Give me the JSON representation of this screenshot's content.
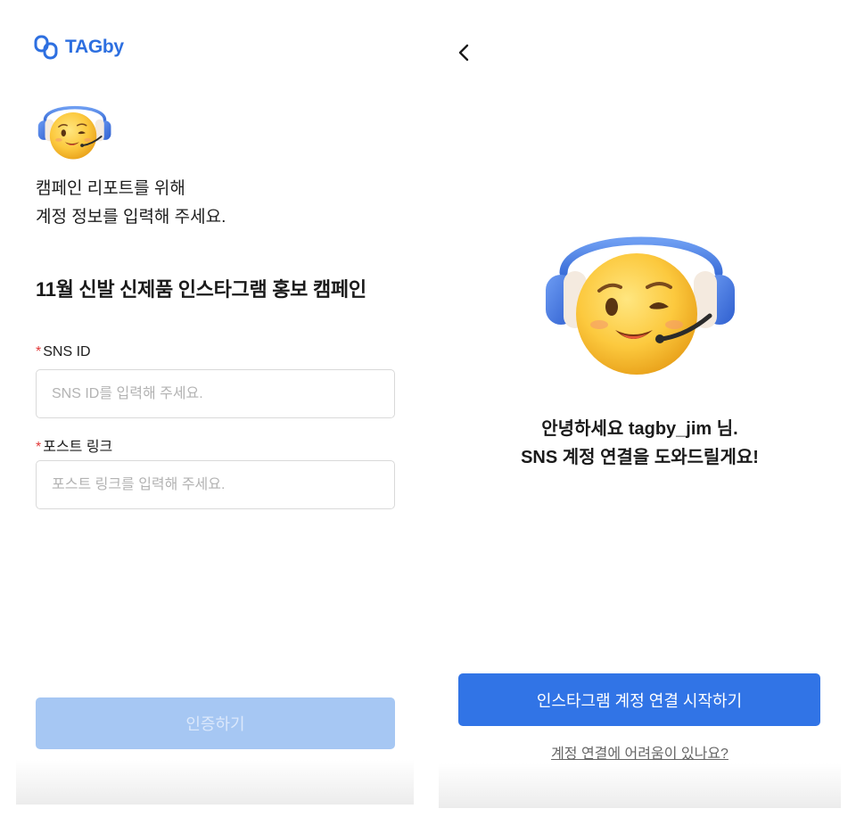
{
  "left": {
    "logo_text": "TAGby",
    "intro_line1": "캠페인 리포트를 위해",
    "intro_line2": "계정 정보를 입력해 주세요.",
    "campaign_title": "11월 신발 신제품 인스타그램 홍보 캠페인",
    "required_mark": "*",
    "sns_label": "SNS ID",
    "sns_placeholder": "SNS ID를 입력해 주세요.",
    "post_label": "포스트 링크",
    "post_placeholder": "포스트 링크를 입력해 주세요.",
    "verify_button": "인증하기"
  },
  "right": {
    "greeting_line1": "안녕하세요 tagby_jim 님.",
    "greeting_line2": "SNS 계정 연결을 도와드릴게요!",
    "start_button": "인스타그램 계정 연결 시작하기",
    "help_link": "계정 연결에 어려움이 있나요?"
  },
  "icons": {
    "logo": "tagby-logo-icon",
    "mascot": "winking-headset-emoji-icon",
    "back": "chevron-left-icon"
  },
  "colors": {
    "brand": "#2d6fe0",
    "primary_button": "#3174e6",
    "disabled_button": "#a6c7f3",
    "required": "#e23a3a"
  }
}
